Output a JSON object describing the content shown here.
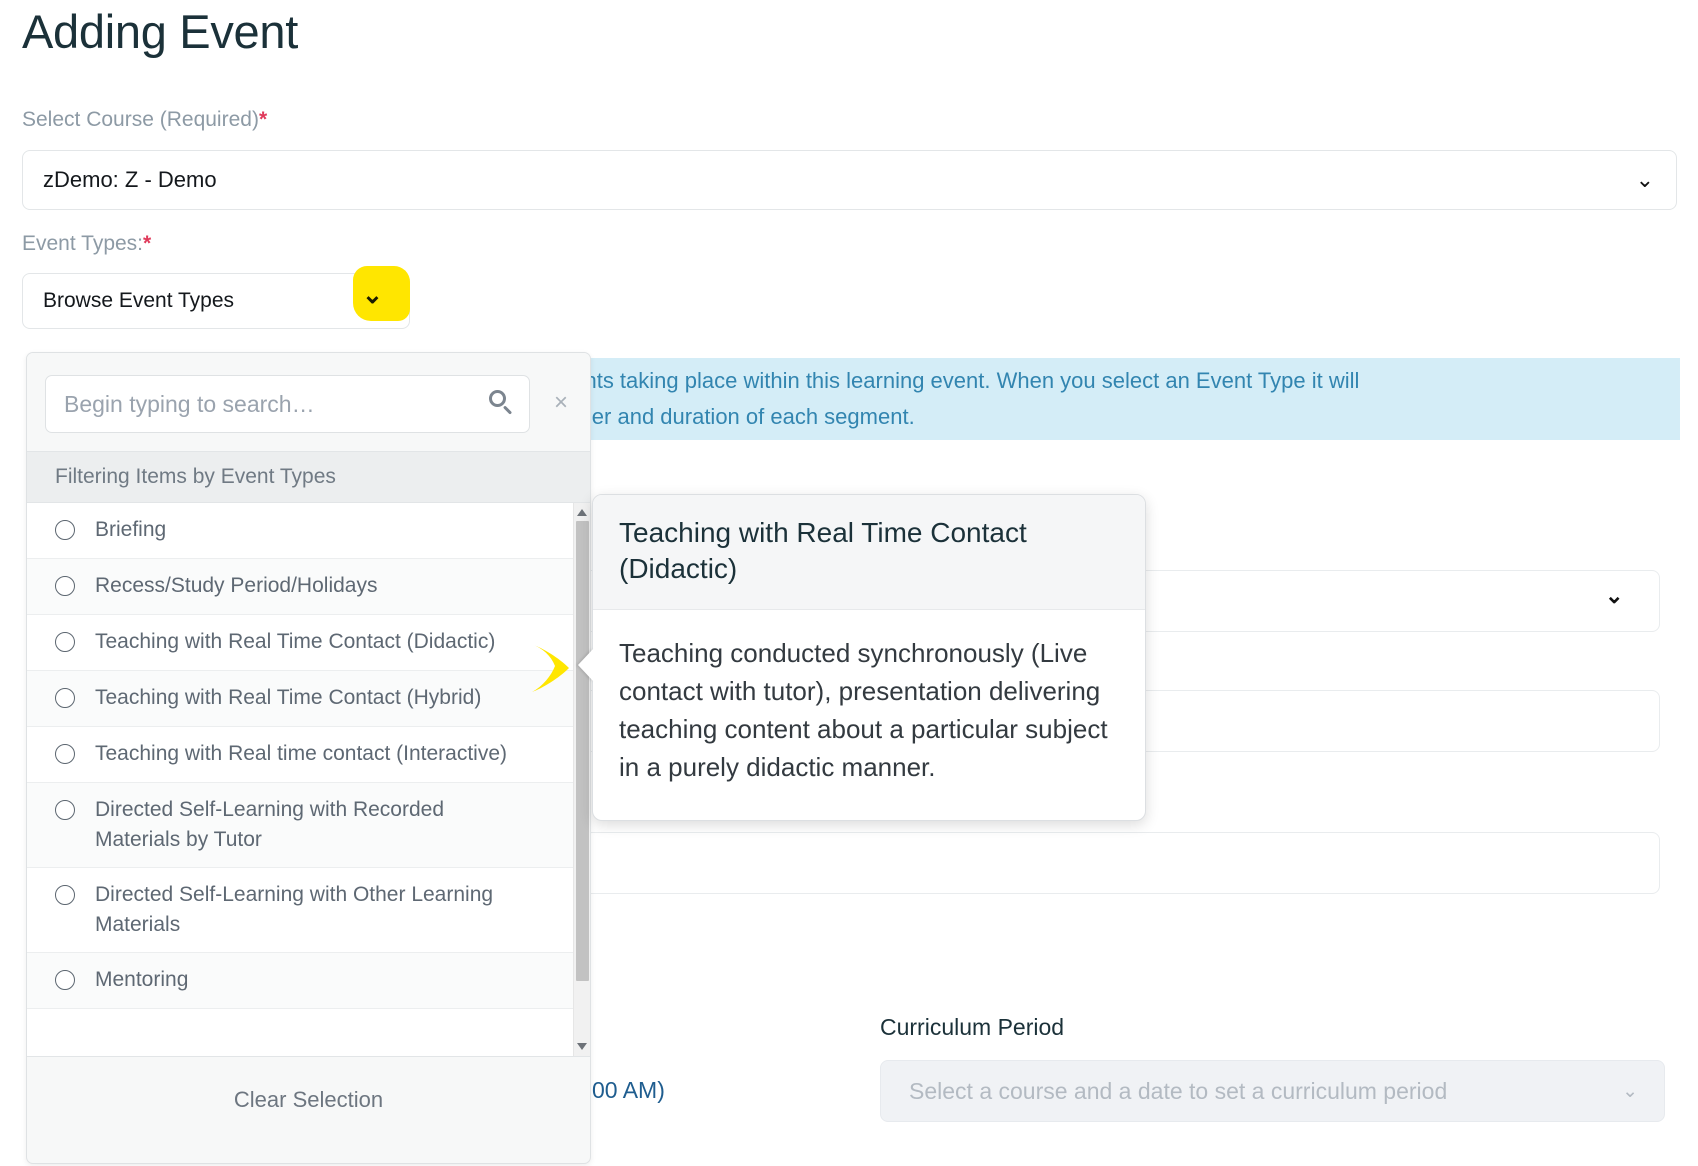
{
  "page": {
    "title": "Adding Event"
  },
  "course_field": {
    "label": "Select Course (Required)",
    "required_mark": "*",
    "value": "zDemo: Z - Demo",
    "chevron": "⌄"
  },
  "event_types_field": {
    "label": "Event Types:",
    "required_mark": "*",
    "value": "Browse Event Types",
    "chevron": "⌄",
    "highlight_color": "#ffe600"
  },
  "info_banner": {
    "line1": "nents taking place within this learning event. When you select an Event Type it will",
    "line2": "order and duration of each segment.",
    "close_label": "×",
    "background": "#d4edf7",
    "text_color": "#3285b0"
  },
  "dropdown": {
    "search_placeholder": "Begin typing to search…",
    "search_value": "",
    "clear_icon": "×",
    "group_header": "Filtering Items by Event Types",
    "items": [
      {
        "label": "Briefing"
      },
      {
        "label": "Recess/Study Period/Holidays"
      },
      {
        "label": "Teaching with Real Time Contact (Didactic)"
      },
      {
        "label": "Teaching with Real Time Contact (Hybrid)"
      },
      {
        "label": "Teaching with Real time contact (Interactive)"
      },
      {
        "label": "Directed Self-Learning with Recorded Materials by Tutor"
      },
      {
        "label": "Directed Self-Learning with Other Learning Materials"
      },
      {
        "label": "Mentoring"
      }
    ],
    "clear_selection": "Clear Selection"
  },
  "tooltip": {
    "title": "Teaching with Real Time Contact (Didactic)",
    "body": "Teaching conducted synchronously (Live contact with tutor), presentation delivering teaching content about a particular subject in a purely didactic manner."
  },
  "curriculum_period": {
    "label": "Curriculum Period",
    "placeholder": "Select a course and a date to set a curriculum period",
    "chevron": "⌄"
  },
  "time_fragment": {
    "text": "00 AM)"
  },
  "ghost_chevron": "⌄"
}
